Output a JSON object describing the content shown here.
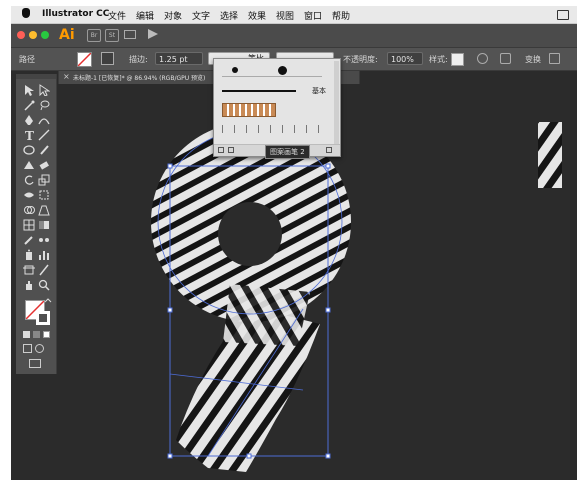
{
  "menubar": {
    "app_name": "Illustrator CC",
    "items": [
      "文件",
      "编辑",
      "对象",
      "文字",
      "选择",
      "效果",
      "视图",
      "窗口",
      "帮助"
    ]
  },
  "appbar": {
    "logo": "Ai",
    "icons": [
      "Br",
      "St"
    ]
  },
  "control_bar": {
    "selection_label": "路径",
    "stroke_label": "描边:",
    "stroke_value": "1.25 pt",
    "profile_label": "等比",
    "opacity_label": "不透明度:",
    "opacity_value": "100%",
    "style_label": "样式:",
    "transform_label": "变换"
  },
  "document_tab": {
    "title": "未标题-1 [已恢复]* @ 86.94% (RGB/GPU 预览)",
    "close_glyph": "×"
  },
  "brush_popup": {
    "basic_label": "基本",
    "tooltip": "图案画笔 2"
  },
  "colors": {
    "accent_orange": "#ff9a00",
    "canvas_bg": "#2b2b2b",
    "selection_blue": "#4d6cd6",
    "stripe_light": "#e6e6e6"
  }
}
